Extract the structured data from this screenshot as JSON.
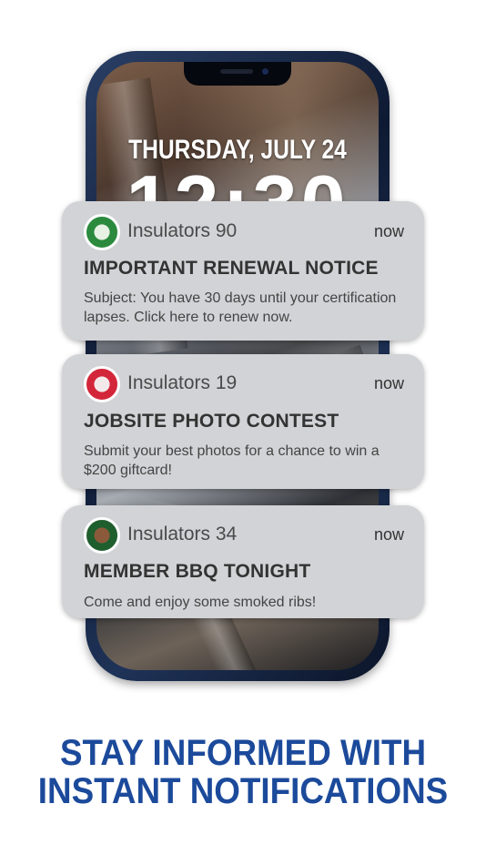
{
  "lockscreen": {
    "date": "THURSDAY, JULY 24",
    "time": "12:30"
  },
  "notifications": [
    {
      "app": "Insulators 90",
      "time": "now",
      "title": "IMPORTANT RENEWAL NOTICE",
      "body": "Subject: You have 30 days until your certification lapses. Click here to renew now.",
      "logo_color": "#2b8a3e"
    },
    {
      "app": "Insulators 19",
      "time": "now",
      "title": "JOBSITE PHOTO CONTEST",
      "body": "Submit your best photos for a chance to win a $200 giftcard!",
      "logo_color": "#d3263a"
    },
    {
      "app": "Insulators 34",
      "time": "now",
      "title": "MEMBER BBQ TONIGHT",
      "body": "Come and enjoy some smoked ribs!",
      "logo_color": "#1f5f2e"
    }
  ],
  "tagline": {
    "line1": "STAY INFORMED WITH",
    "line2": "INSTANT NOTIFICATIONS"
  },
  "colors": {
    "tagline": "#1c4a9b",
    "card": "#d2d3d6",
    "phone_frame": "#1f3358"
  }
}
